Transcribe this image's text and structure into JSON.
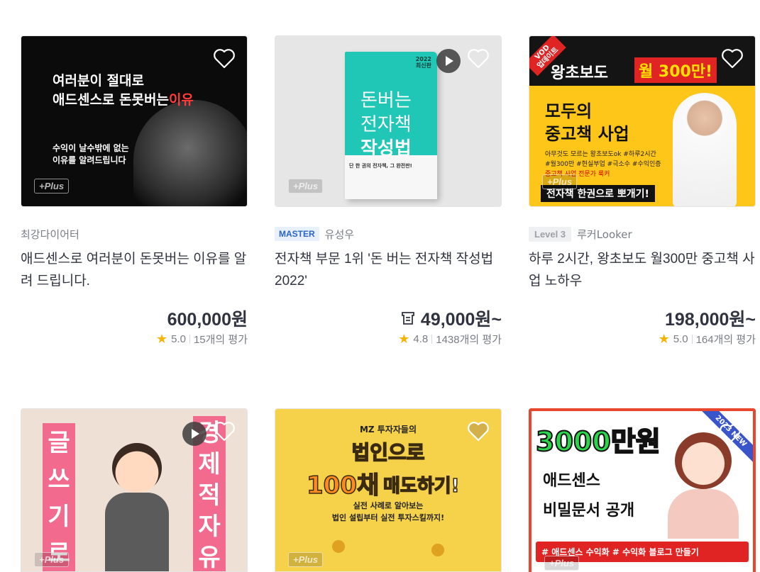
{
  "cards": [
    {
      "thumb_text": [
        "여러분이 절대로",
        "애드센스로 돈못버는",
        "이유",
        "수익이 날수밖에 없는",
        "이유를 알려드립니다"
      ],
      "plus_label": "+Plus",
      "seller": "최강다이어터",
      "title": "애드센스로 여러분이 돈못버는 이유를 알려 드립니다.",
      "price": "600,000원",
      "rating": "5.0",
      "reviews": "15개의 평가"
    },
    {
      "thumb_text": [
        "돈버는",
        "전자책",
        "작성법",
        "2022",
        "최신판",
        "단 한 권의 전자책, 그 완전판!"
      ],
      "plus_label": "+Plus",
      "badge": "MASTER",
      "seller": "유성우",
      "title": "전자책 부문 1위 '돈 버는 전자책 작성법 2022'",
      "price": "49,000원~",
      "rating": "4.8",
      "reviews": "1438개의 평가"
    },
    {
      "thumb_text": [
        "VOD",
        "업데이트",
        "왕초보도",
        "월 300만!",
        "모두의",
        "중고책 사업",
        "아무것도 모르는 왕초보도ok #하루2시간",
        "#월300만 #현실부업 #극소수 #수익인증",
        "중고책 사업 전문가 룩커",
        "전자책 한권으로 뽀개기!"
      ],
      "plus_label": "+Plus",
      "badge": "Level 3",
      "seller": "루커Looker",
      "title": "하루 2시간, 왕초보도 월300만 중고책 사업 노하우",
      "price": "198,000원~",
      "rating": "5.0",
      "reviews": "164개의 평가"
    },
    {
      "thumb_text": [
        "글",
        "쓰",
        "기",
        "로",
        "경",
        "제",
        "적",
        "자",
        "유"
      ],
      "plus_label": "+Plus"
    },
    {
      "thumb_text": [
        "MZ 투자자들의",
        "법인으로",
        "100채",
        "매도하기!",
        "실전 사례로 알아보는",
        "법인 설립부터 실전 투자스킬까지!"
      ],
      "plus_label": "+Plus"
    },
    {
      "thumb_text": [
        "3000만원",
        "애드센스",
        "비밀문서 공개",
        "# 애드센스 수익화  # 수익화 블로그 만들기",
        "2023 NEW"
      ],
      "plus_label": "+Plus"
    }
  ],
  "colors": {
    "star": "#f5b400",
    "master": "#2a65c8",
    "price": "#303441"
  },
  "icons": {
    "favorite": "heart-icon",
    "video": "play-icon",
    "coupon": "coupon-icon",
    "rating": "star-icon"
  }
}
